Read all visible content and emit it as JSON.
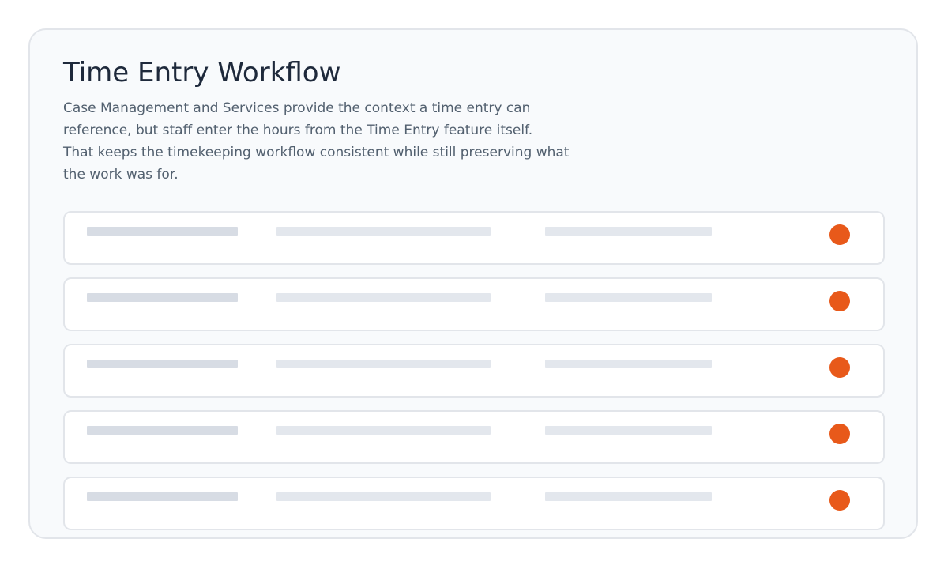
{
  "panel": {
    "title": "Time Entry Workflow",
    "description_lines": [
      "Case Management and Services provide the context a time entry can",
      "reference, but staff enter the hours from the Time Entry feature itself.",
      "That keeps the timekeeping workflow consistent while still preserving what",
      "the work was for."
    ]
  },
  "rows": [
    {
      "status": "active"
    },
    {
      "status": "active"
    },
    {
      "status": "active"
    },
    {
      "status": "active"
    },
    {
      "status": "active"
    }
  ],
  "colors": {
    "accent": "#e8591a",
    "title": "#1e293b",
    "text": "#52606f",
    "placeholder_primary": "#d7dce4",
    "placeholder_secondary": "#e3e7ed"
  }
}
